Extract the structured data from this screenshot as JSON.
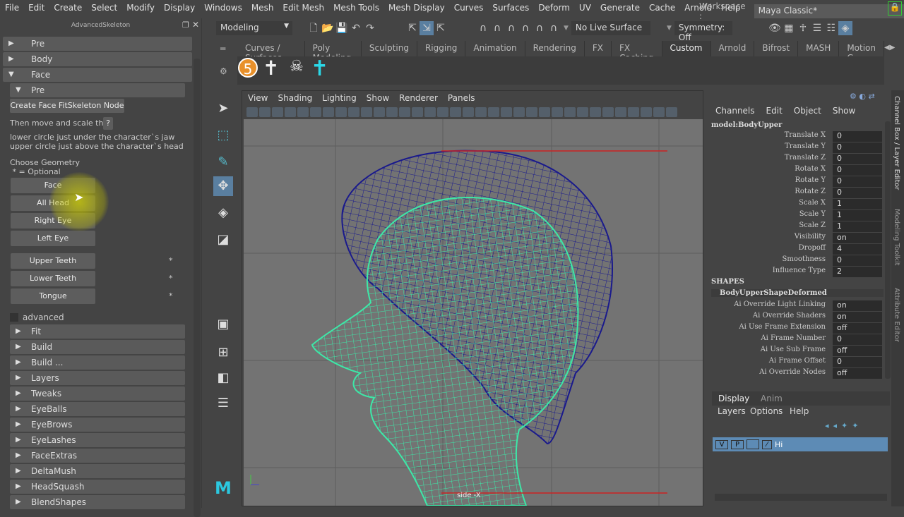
{
  "menubar": {
    "items": [
      "File",
      "Edit",
      "Create",
      "Select",
      "Modify",
      "Display",
      "Windows",
      "Mesh",
      "Edit Mesh",
      "Mesh Tools",
      "Mesh Display",
      "Curves",
      "Surfaces",
      "Deform",
      "UV",
      "Generate",
      "Cache",
      "Arnold",
      "Help"
    ],
    "workspace_label": "Workspace :",
    "workspace_value": "Maya Classic*"
  },
  "left_panel": {
    "title": "AdvancedSkeleton",
    "sections_top": [
      {
        "label": "Pre",
        "open": false
      },
      {
        "label": "Body",
        "open": false
      },
      {
        "label": "Face",
        "open": true
      }
    ],
    "face_pre": "Pre",
    "create_button": "Create Face FitSkeleton Node",
    "move_scale_text": "Then move and scale this:",
    "help_button": "?",
    "instructions": "lower circle just under the character`s jaw\nupper circle just above the character`s head",
    "choose_geometry": "Choose Geometry",
    "optional_note": " * = Optional",
    "geometry_buttons": [
      {
        "label": "Face",
        "optional": ""
      },
      {
        "label": "All Head",
        "optional": ""
      },
      {
        "label": "Right Eye",
        "optional": ""
      },
      {
        "label": "Left Eye",
        "optional": ""
      },
      {
        "label": "Upper Teeth",
        "optional": "*"
      },
      {
        "label": "Lower Teeth",
        "optional": "*"
      },
      {
        "label": "Tongue",
        "optional": "*"
      }
    ],
    "advanced_label": "advanced",
    "sections_bottom": [
      "Fit",
      "Build",
      "Build ...",
      "Layers",
      "Tweaks",
      "EyeBalls",
      "EyeBrows",
      "EyeLashes",
      "FaceExtras",
      "DeltaMush",
      "HeadSquash",
      "BlendShapes"
    ]
  },
  "status_line": {
    "mode": "Modeling",
    "live_surface": "No Live Surface",
    "symmetry": "Symmetry: Off"
  },
  "shelf": {
    "tabs": [
      "Curves / Surfaces",
      "Poly Modeling",
      "Sculpting",
      "Rigging",
      "Animation",
      "Rendering",
      "FX",
      "FX Caching",
      "Custom",
      "Arnold",
      "Bifrost",
      "MASH",
      "Motion G"
    ],
    "active_tab": "Custom"
  },
  "viewport": {
    "menu": [
      "View",
      "Shading",
      "Lighting",
      "Show",
      "Renderer",
      "Panels"
    ],
    "camera_label": "side -X",
    "colors": {
      "hair": "#1a1a8c",
      "face": "#3de8a8",
      "guide": "#cc2222"
    }
  },
  "channel_box": {
    "menu": [
      "Channels",
      "Edit",
      "Object",
      "Show"
    ],
    "object": "model:BodyUpper",
    "channels": [
      [
        "Translate X",
        "0"
      ],
      [
        "Translate Y",
        "0"
      ],
      [
        "Translate Z",
        "0"
      ],
      [
        "Rotate X",
        "0"
      ],
      [
        "Rotate Y",
        "0"
      ],
      [
        "Rotate Z",
        "0"
      ],
      [
        "Scale X",
        "1"
      ],
      [
        "Scale Y",
        "1"
      ],
      [
        "Scale Z",
        "1"
      ],
      [
        "Visibility",
        "on"
      ],
      [
        "Dropoff",
        "4"
      ],
      [
        "Smoothness",
        "0"
      ],
      [
        "Influence Type",
        "2"
      ]
    ],
    "shapes_label": "SHAPES",
    "shape_name": "BodyUpperShapeDeformed",
    "shape_channels": [
      [
        "Ai Override Light Linking",
        "on"
      ],
      [
        "Ai Override Shaders",
        "on"
      ],
      [
        "Ai Use Frame Extension",
        "off"
      ],
      [
        "Ai Frame Number",
        "0"
      ],
      [
        "Ai Use Sub Frame",
        "off"
      ],
      [
        "Ai Frame Offset",
        "0"
      ],
      [
        "Ai Override Nodes",
        "off"
      ]
    ]
  },
  "layer_editor": {
    "tabs": [
      "Display",
      "Anim"
    ],
    "menu": [
      "Layers",
      "Options",
      "Help"
    ],
    "layer": {
      "v": "V",
      "p": "P",
      "name": "Hi"
    }
  },
  "side_tabs": [
    "Channel Box / Layer Editor",
    "Modeling Toolkit",
    "Attribute Editor"
  ]
}
